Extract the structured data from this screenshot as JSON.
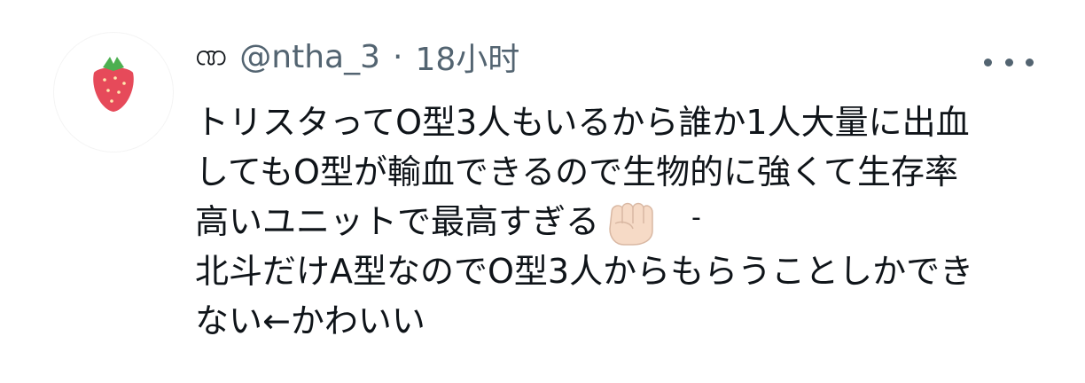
{
  "avatar": {
    "icon": "strawberry-icon",
    "colors": {
      "berry": "#e64a5a",
      "leaf": "#4caf50"
    }
  },
  "user": {
    "display_name": "ဏ",
    "handle": "@ntha_3",
    "separator": "·",
    "time": "18小时"
  },
  "menu": {
    "icon": "more-icon"
  },
  "tweet": {
    "lines": [
      "トリスタってO型3人もいるから誰か1人大量に出血",
      "してもO型が輸血できるので生物的に強くて生存率",
      "高いユニットで最高すぎる",
      "北斗だけA型なのでO型3人からもらうことしかでき",
      "ない←かわいい"
    ],
    "emoji": "fist-emoji",
    "trailing_mark": "-"
  }
}
